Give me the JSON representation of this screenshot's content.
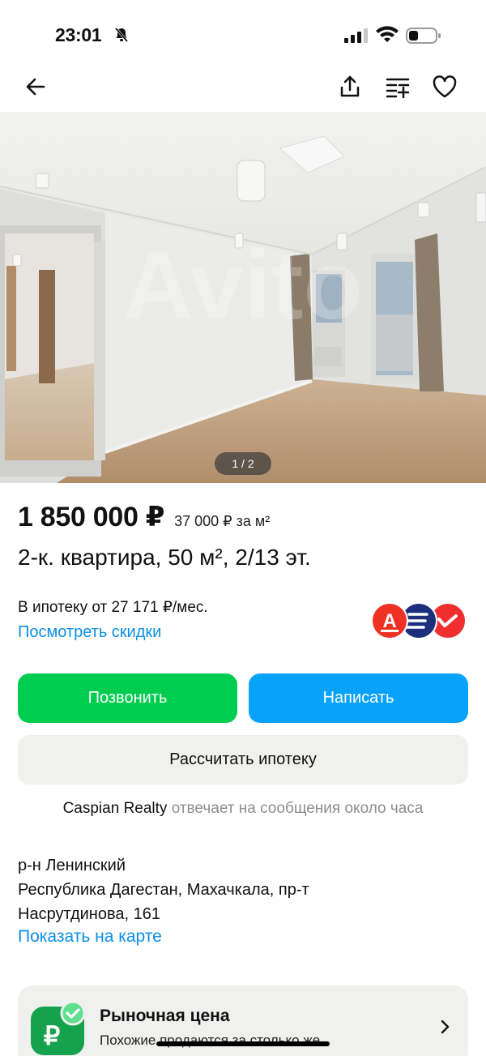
{
  "status_bar": {
    "time": "23:01"
  },
  "gallery": {
    "counter": "1 / 2"
  },
  "listing": {
    "price": "1 850 000 ₽",
    "price_per_m": "37 000 ₽ за м²",
    "title": "2-к. квартира, 50 м², 2/13 эт."
  },
  "mortgage": {
    "text": "В ипотеку от 27 171 ₽/мес.",
    "discounts_link": "Посмотреть скидки",
    "bank_icons": [
      "alfa-bank-icon",
      "bank-stripes-icon",
      "bank-red-icon"
    ]
  },
  "actions": {
    "call_label": "Позвонить",
    "write_label": "Написать",
    "calc_label": "Рассчитать ипотеку"
  },
  "seller": {
    "name": "Caspian Realty",
    "response": "отвечает на сообщения около часа"
  },
  "address": {
    "district": "р-н Ленинский",
    "line1": "Республика Дагестан, Махачкала, пр-т",
    "line2": "Насрутдинова, 161",
    "map_link": "Показать на карте"
  },
  "market_price": {
    "title": "Рыночная цена",
    "subtitle": "Похожие продаются за столько же"
  },
  "colors": {
    "call": "#00cc4f",
    "write": "#07a3fa",
    "link": "#0c8fe6",
    "card": "#f0f0ee"
  }
}
